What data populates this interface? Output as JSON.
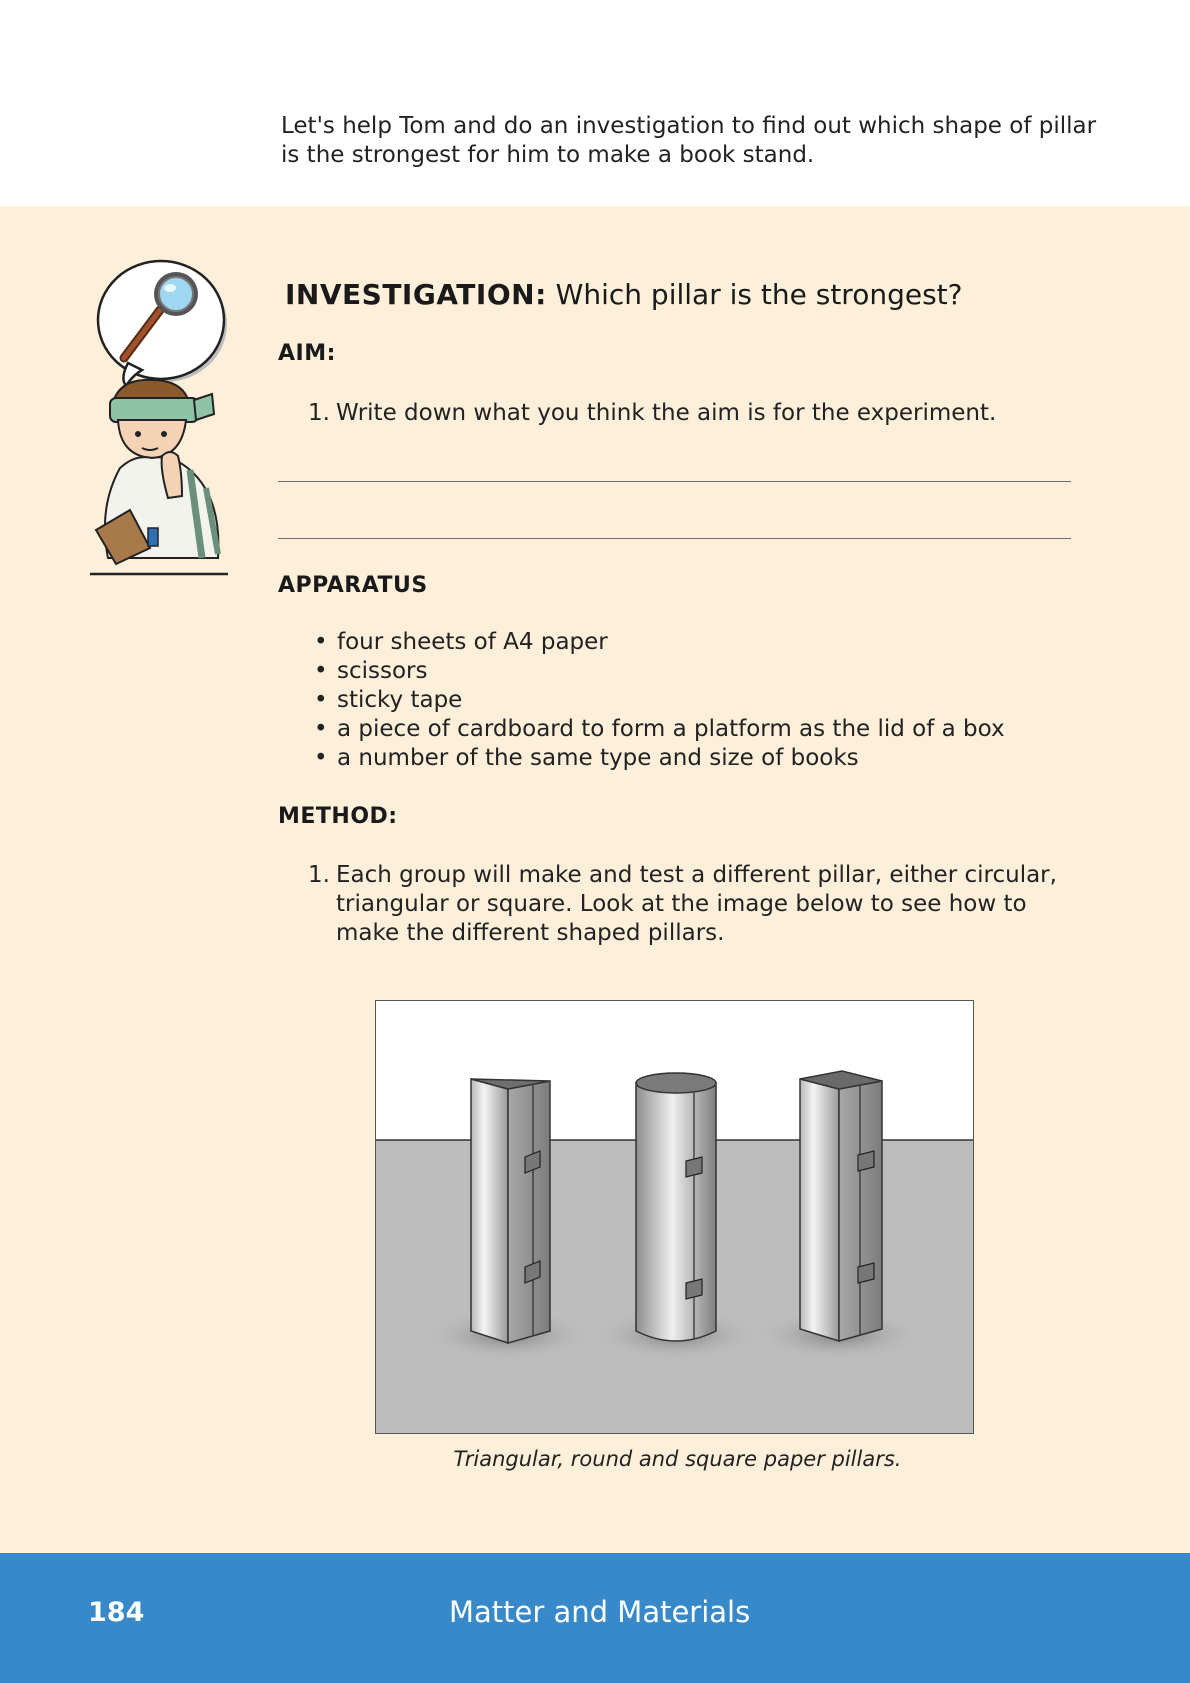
{
  "intro": "Let's help Tom and do an investigation to find out which shape of pillar is the strongest for him to make a book stand.",
  "investigation": {
    "label": "INVESTIGATION:",
    "question": "Which pillar is the strongest?"
  },
  "aim": {
    "heading": "AIM:",
    "items": [
      {
        "num": "1.",
        "text": "Write down what you think the aim is for the experiment."
      }
    ]
  },
  "apparatus": {
    "heading": "APPARATUS",
    "items": [
      "four sheets of A4 paper",
      "scissors",
      "sticky tape",
      "a piece of cardboard to form a platform as the lid of a box",
      "a number of the same type and size of books"
    ]
  },
  "method": {
    "heading": "METHOD:",
    "items": [
      {
        "num": "1.",
        "text": "Each group will make and test a different pillar, either circular, triangular or square. Look at the image below to see how to make the different shaped pillars."
      }
    ]
  },
  "figure": {
    "caption": "Triangular, round and square paper pillars.",
    "pillars": [
      "triangular",
      "round",
      "square"
    ]
  },
  "icons": {
    "scientist": "scientist-with-magnifying-glass-icon"
  },
  "colors": {
    "panel_background": "#fdefd9",
    "footer_background": "#3889c9"
  },
  "footer": {
    "page_number": "184",
    "chapter": "Matter and Materials"
  }
}
